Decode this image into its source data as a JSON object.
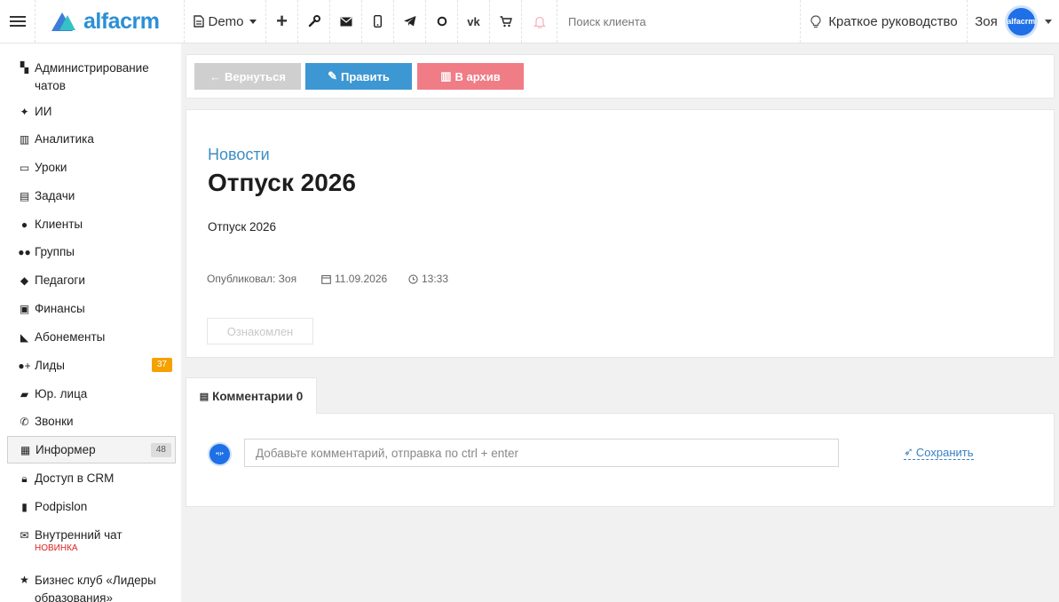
{
  "topbar": {
    "logo_text": "alfacrm",
    "branch": "Demo",
    "icons": [
      "plus-icon",
      "wrench-icon",
      "envelope-icon",
      "mobile-icon",
      "telegram-icon",
      "whatsapp-icon",
      "vk-icon",
      "cart-icon",
      "bell-icon"
    ],
    "search_placeholder": "Поиск клиента",
    "guide_label": "Краткое руководство",
    "user_name": "Зоя",
    "avatar_text": "alfacrm"
  },
  "sidebar": {
    "items": [
      {
        "label": "Администрирование чатов",
        "icon": "chats-admin-icon"
      },
      {
        "label": "ИИ",
        "icon": "sparkles-icon"
      },
      {
        "label": "Аналитика",
        "icon": "map-icon"
      },
      {
        "label": "Уроки",
        "icon": "calendar-icon"
      },
      {
        "label": "Задачи",
        "icon": "clipboard-icon"
      },
      {
        "label": "Клиенты",
        "icon": "user-icon"
      },
      {
        "label": "Группы",
        "icon": "users-icon"
      },
      {
        "label": "Педагоги",
        "icon": "graduation-cap-icon"
      },
      {
        "label": "Финансы",
        "icon": "money-icon"
      },
      {
        "label": "Абонементы",
        "icon": "tag-icon"
      },
      {
        "label": "Лиды",
        "icon": "user-plus-icon",
        "badge": "37"
      },
      {
        "label": "Юр. лица",
        "icon": "briefcase-icon"
      },
      {
        "label": "Звонки",
        "icon": "phone-icon"
      },
      {
        "label": "Информер",
        "icon": "informer-icon",
        "badge": "48",
        "active": true
      },
      {
        "label": "Доступ в CRM",
        "icon": "lock-icon"
      },
      {
        "label": "Podpislon",
        "icon": "file-icon"
      },
      {
        "label": "Внутренний чат",
        "icon": "envelope-icon",
        "tag": "НОВИНКА"
      },
      {
        "label": "Бизнес клуб «Лидеры образования»",
        "icon": "star-icon"
      }
    ]
  },
  "actions": {
    "back_label": "Вернуться",
    "edit_label": "Править",
    "archive_label": "В архив"
  },
  "post": {
    "category": "Новости",
    "title": "Отпуск 2026",
    "body": "Отпуск 2026",
    "author_label": "Опубликовал: Зоя",
    "date": "11.09.2026",
    "time": "13:33",
    "ack_label": "Ознакомлен"
  },
  "comments": {
    "tab_label": "Комментарии 0",
    "input_placeholder": "Добавьте комментарий, отправка по ctrl + enter",
    "save_label": "Сохранить"
  }
}
